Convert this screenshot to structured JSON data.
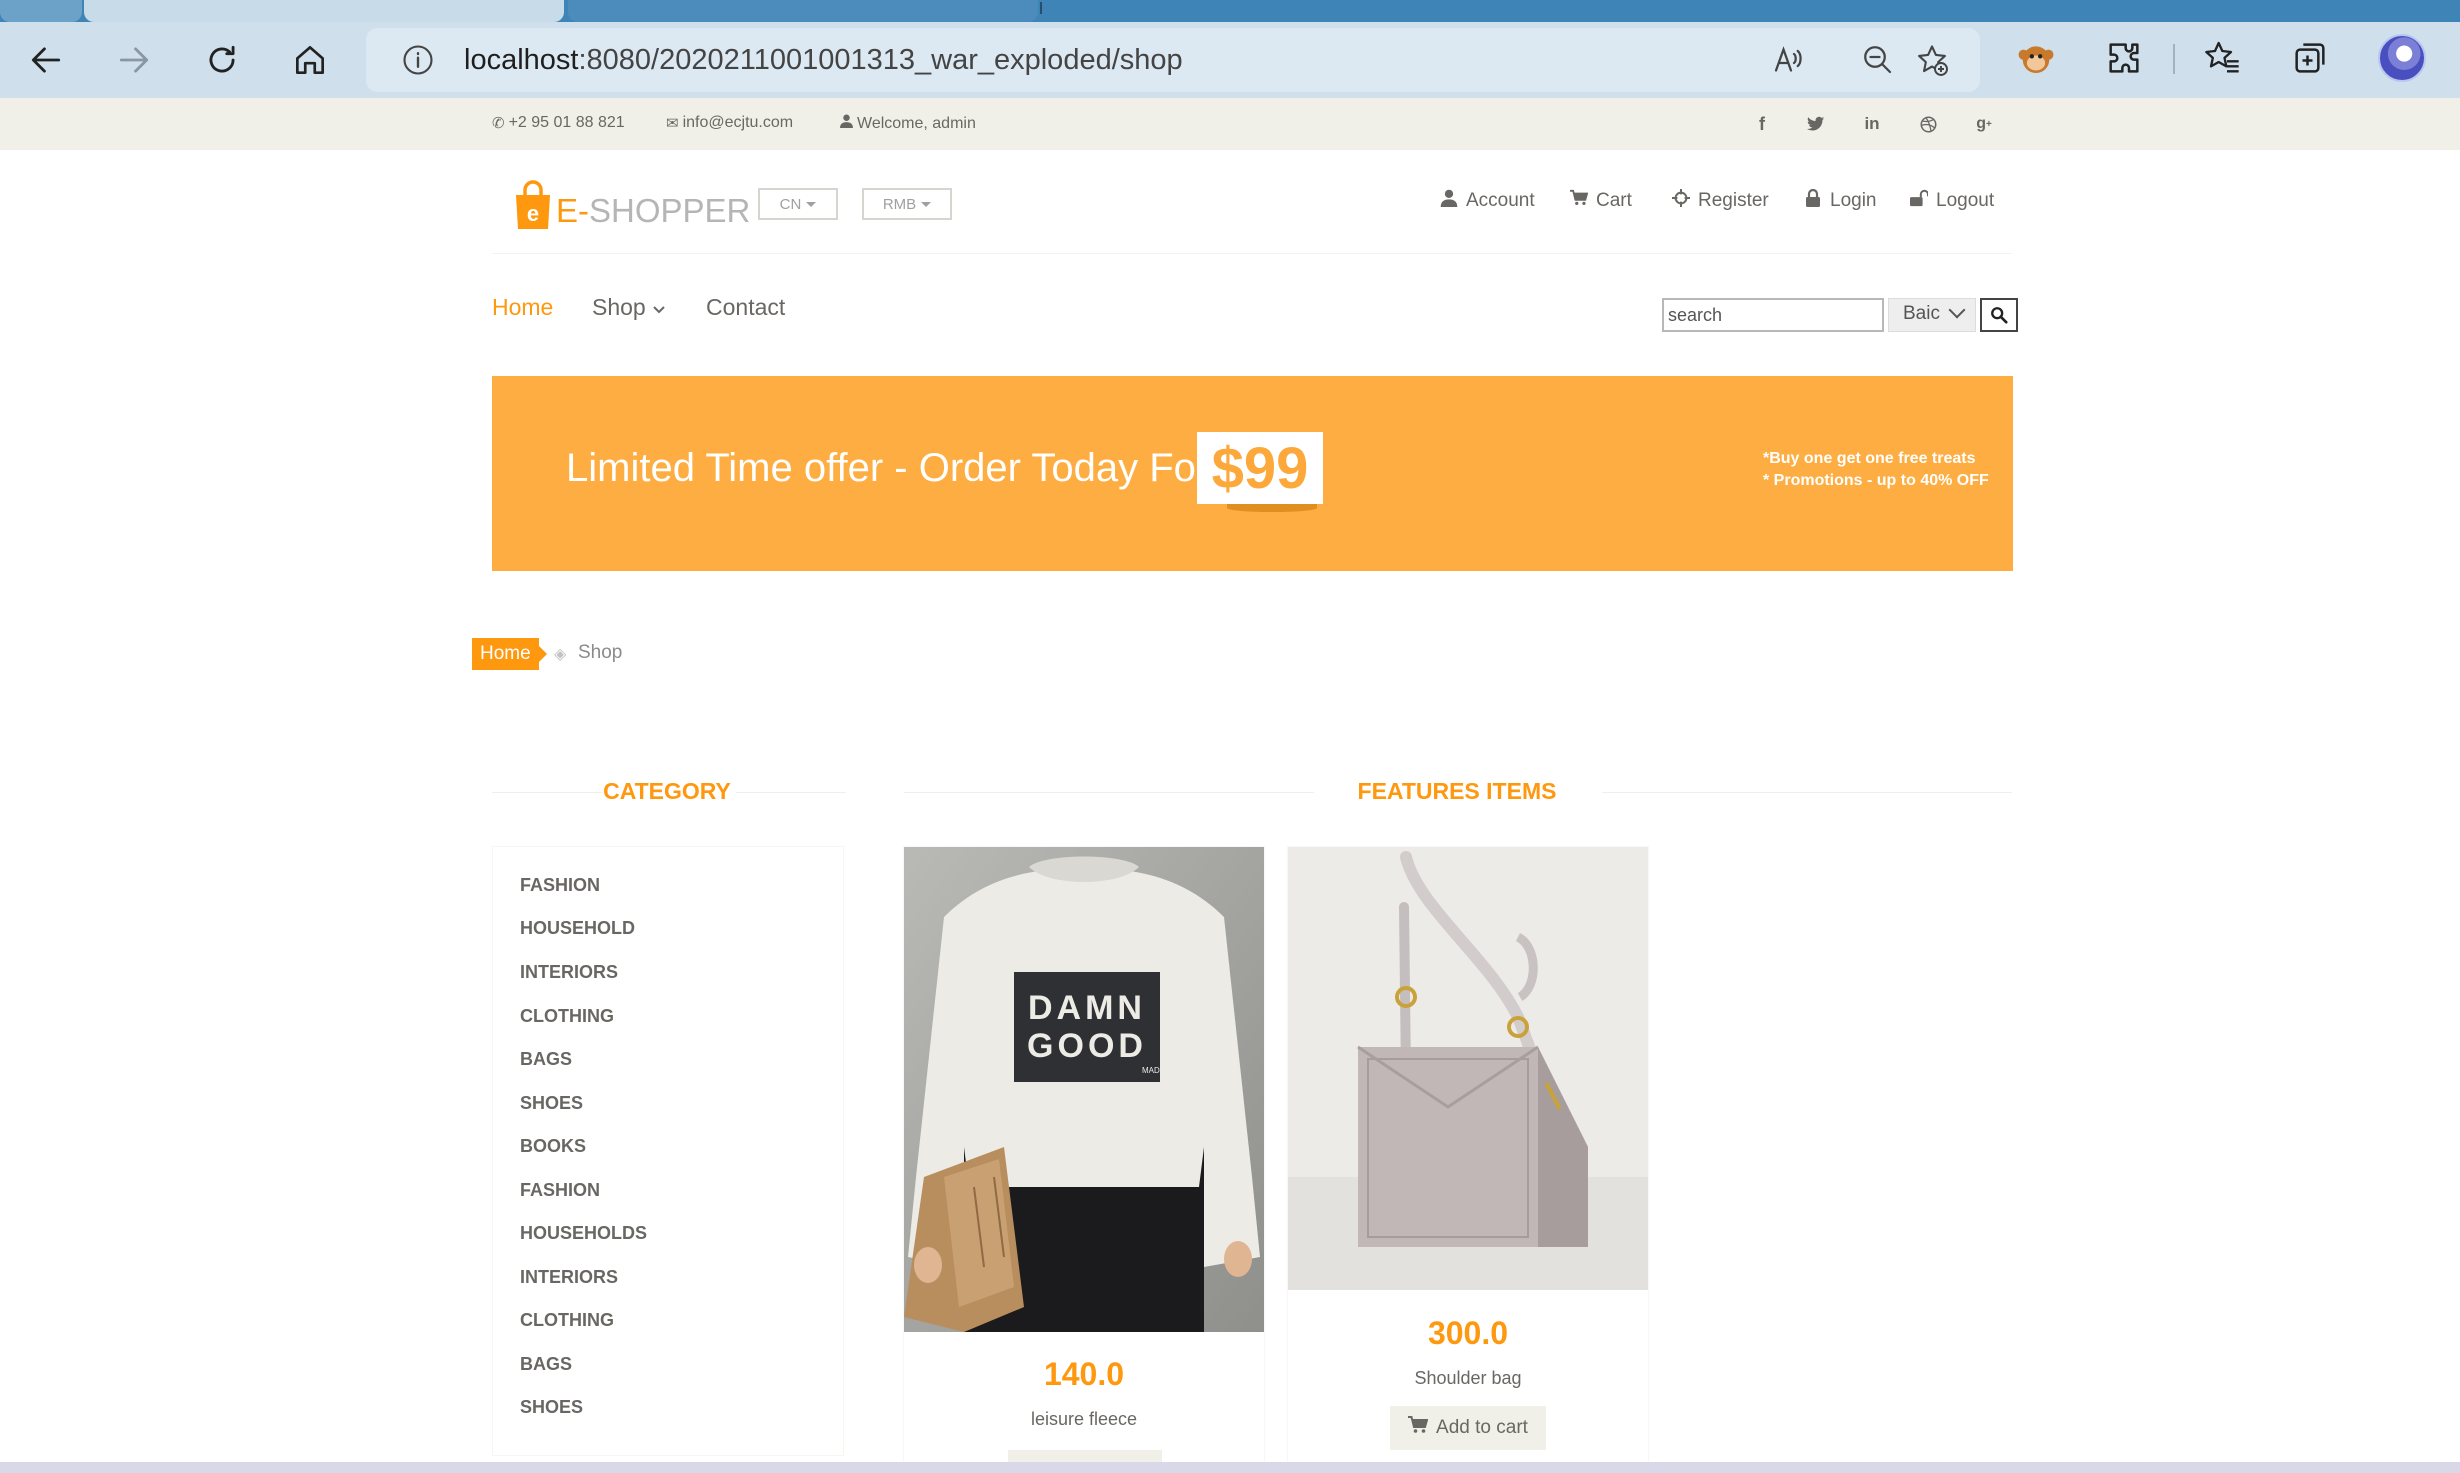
{
  "browser": {
    "url_host": "localhost",
    "url_path": ":8080/2020211001001313_war_exploded/shop"
  },
  "header_top": {
    "phone": "+2 95 01 88 821",
    "email": "info@ecjtu.com",
    "welcome": "Welcome, admin",
    "social": [
      "f",
      "t",
      "in",
      "dribbble",
      "g+"
    ]
  },
  "logo": {
    "prefix": "E-",
    "name": "SHOPPER"
  },
  "header_middle": {
    "language": "CN",
    "currency": "RMB",
    "links": {
      "account": "Account",
      "cart": "Cart",
      "register": "Register",
      "login": "Login",
      "logout": "Logout"
    }
  },
  "nav": {
    "home": "Home",
    "shop": "Shop",
    "contact": "Contact"
  },
  "search": {
    "placeholder": "search",
    "value": "search",
    "select": "Baic"
  },
  "banner": {
    "headline": "Limited Time offer - Order Today For",
    "price": "$99",
    "note1": "*Buy one get one free treats",
    "note2": "* Promotions - up to 40% OFF"
  },
  "breadcrumb": {
    "home": "Home",
    "current": "Shop"
  },
  "category": {
    "title": "CATEGORY",
    "items": [
      "FASHION",
      "HOUSEHOLD",
      "INTERIORS",
      "CLOTHING",
      "BAGS",
      "SHOES",
      "BOOKS",
      "FASHION",
      "HOUSEHOLDS",
      "INTERIORS",
      "CLOTHING",
      "BAGS",
      "SHOES"
    ]
  },
  "features": {
    "title": "FEATURES ITEMS",
    "add_to_cart": "Add to cart",
    "products": [
      {
        "price": "140.0",
        "name": "leisure fleece",
        "print_line1": "DAMN",
        "print_line2": "GOOD",
        "print_tag": "MAD"
      },
      {
        "price": "300.0",
        "name": "Shoulder bag"
      }
    ]
  },
  "colors": {
    "accent": "#FE980F",
    "banner": "#FDAD41",
    "text": "#696763",
    "topbar": "#F0F0E9"
  }
}
